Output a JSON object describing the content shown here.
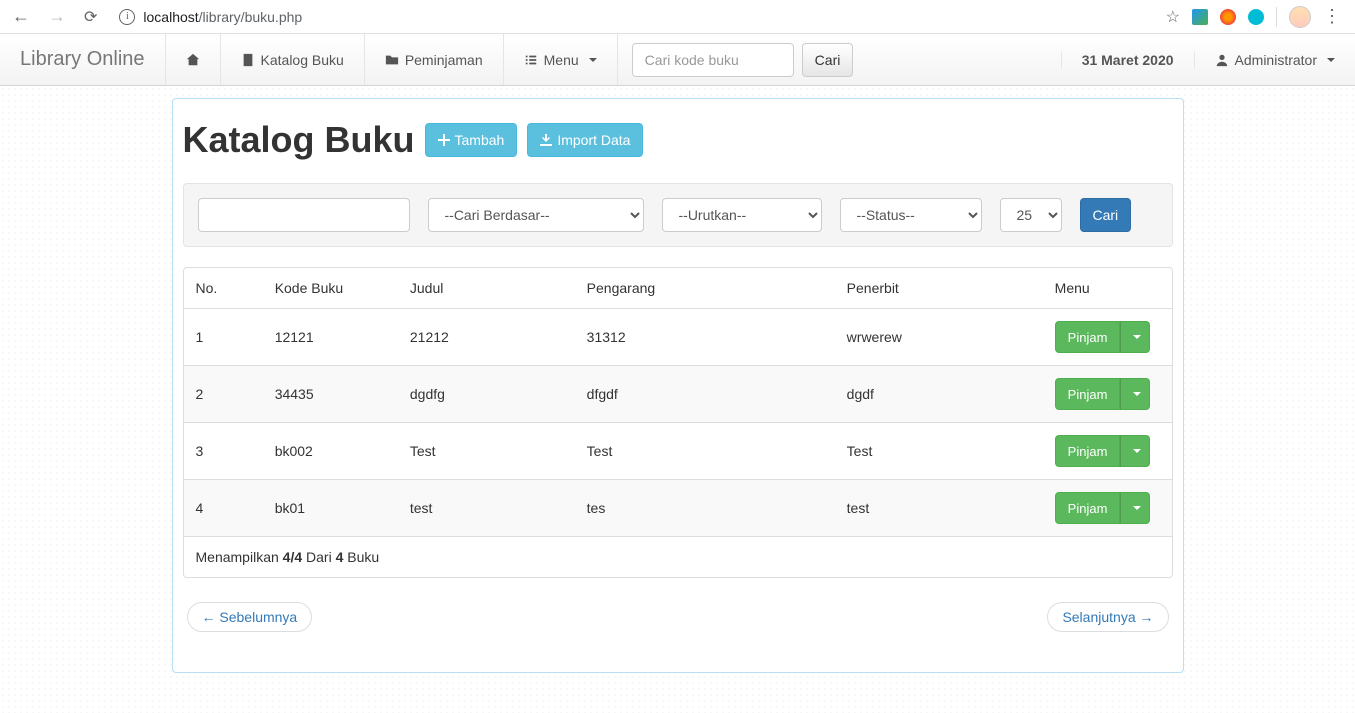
{
  "browser": {
    "url_host": "localhost",
    "url_path": "/library/buku.php"
  },
  "navbar": {
    "brand": "Library Online",
    "katalog": "Katalog Buku",
    "peminjaman": "Peminjaman",
    "menu": "Menu",
    "search_placeholder": "Cari kode buku",
    "search_btn": "Cari",
    "date": "31 Maret 2020",
    "user": "Administrator"
  },
  "header": {
    "title": "Katalog Buku",
    "tambah": "Tambah",
    "import": "Import Data"
  },
  "filters": {
    "cari_berdasar": "--Cari Berdasar--",
    "urutkan": "--Urutkan--",
    "status": "--Status--",
    "limit": "25",
    "cari_btn": "Cari"
  },
  "table": {
    "columns": {
      "no": "No.",
      "kode": "Kode Buku",
      "judul": "Judul",
      "pengarang": "Pengarang",
      "penerbit": "Penerbit",
      "menu": "Menu"
    },
    "action_label": "Pinjam",
    "rows": [
      {
        "no": "1",
        "kode": "12121",
        "judul": "21212",
        "pengarang": "31312",
        "penerbit": "wrwerew"
      },
      {
        "no": "2",
        "kode": "34435",
        "judul": "dgdfg",
        "pengarang": "dfgdf",
        "penerbit": "dgdf"
      },
      {
        "no": "3",
        "kode": "bk002",
        "judul": "Test",
        "pengarang": "Test",
        "penerbit": "Test"
      },
      {
        "no": "4",
        "kode": "bk01",
        "judul": "test",
        "pengarang": "tes",
        "penerbit": "test"
      }
    ],
    "footer_prefix": "Menampilkan ",
    "footer_count": "4/4",
    "footer_mid": " Dari ",
    "footer_total": "4",
    "footer_suffix": " Buku"
  },
  "pager": {
    "prev": "← Sebelumnya",
    "next": "Selanjutnya →"
  }
}
